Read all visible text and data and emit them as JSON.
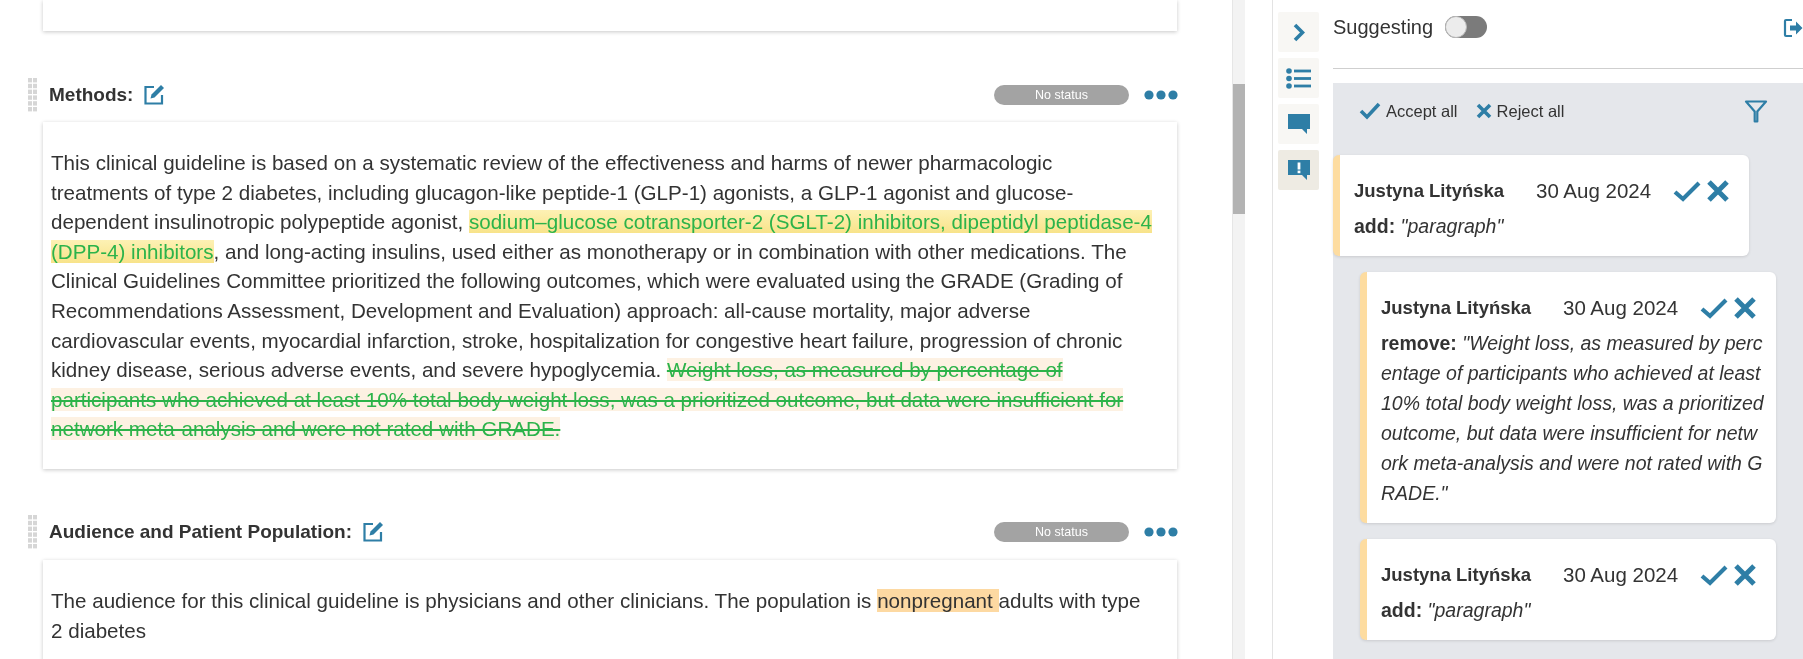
{
  "document": {
    "sections": [
      {
        "title": "Methods:",
        "status": "No status",
        "paragraph": [
          {
            "kind": "plain",
            "text": "This clinical guideline is based on a systematic review of the effectiveness and harms of newer pharmacologic treatments of type 2 diabetes, including glucagon-like peptide-1 (GLP-1) agonists, a GLP-1 agonist and glucose-dependent insulinotropic polypeptide agonist, "
          },
          {
            "kind": "insert",
            "text": "sodium–glucose cotransporter-2 (SGLT-2) inhibitors, dipeptidyl peptidase-4 (DPP-4) inhibitors"
          },
          {
            "kind": "plain",
            "text": ", and long-acting insulins, used either as monotherapy or in combination with other medications. The Clinical Guidelines Committee prioritized the following outcomes, which were evaluated using the GRADE (Grading of Recommendations Assessment, Development and Evaluation) approach: all-cause mortality, major adverse cardiovascular events, myocardial infarction, stroke, hospitalization for congestive heart failure, progression of chronic kidney disease, serious adverse events, and severe hypoglycemia. "
          },
          {
            "kind": "delete",
            "text": "Weight loss, as measured by percentage of participants who achieved at least 10% total body weight loss, was a prioritized outcome, but data were insufficient for network meta-analysis and were not rated with GRADE."
          }
        ]
      },
      {
        "title": "Audience and Patient Population:",
        "status": "No status",
        "paragraph": [
          {
            "kind": "plain",
            "text": "The audience for this clinical guideline is physicians and other clinicians. The population is "
          },
          {
            "kind": "comment",
            "text": "nonpregnant "
          },
          {
            "kind": "plain",
            "text": "adults with type 2 diabetes"
          }
        ]
      }
    ]
  },
  "sidebar": {
    "tabs": [
      {
        "kind": "collapse",
        "selected": false
      },
      {
        "kind": "outline",
        "selected": false
      },
      {
        "kind": "comments",
        "selected": false
      },
      {
        "kind": "suggestions",
        "selected": true
      }
    ],
    "suggesting": {
      "label": "Suggesting",
      "on": false
    },
    "actions": [
      {
        "kind": "accept",
        "label": "Accept all"
      },
      {
        "kind": "reject",
        "label": "Reject all"
      }
    ],
    "suggestions": [
      {
        "author": "Justyna Lityńska",
        "date": "30 Aug 2024",
        "change": "**add:** *\"paragraph\"*",
        "children": [
          {
            "author": "Justyna Lityńska",
            "date": "30 Aug 2024",
            "change": "**remove:** *\"Weight loss, as measured by percentage of participants who achieved at least 10% total body weight loss, was a prioritized outcome, but data were insufficient for network meta-analysis and were not rated with GRADE.\"*"
          },
          {
            "author": "Justyna Lityńska",
            "date": "30 Aug 2024",
            "change": "**add:** *\"paragraph\"*"
          }
        ]
      }
    ]
  }
}
